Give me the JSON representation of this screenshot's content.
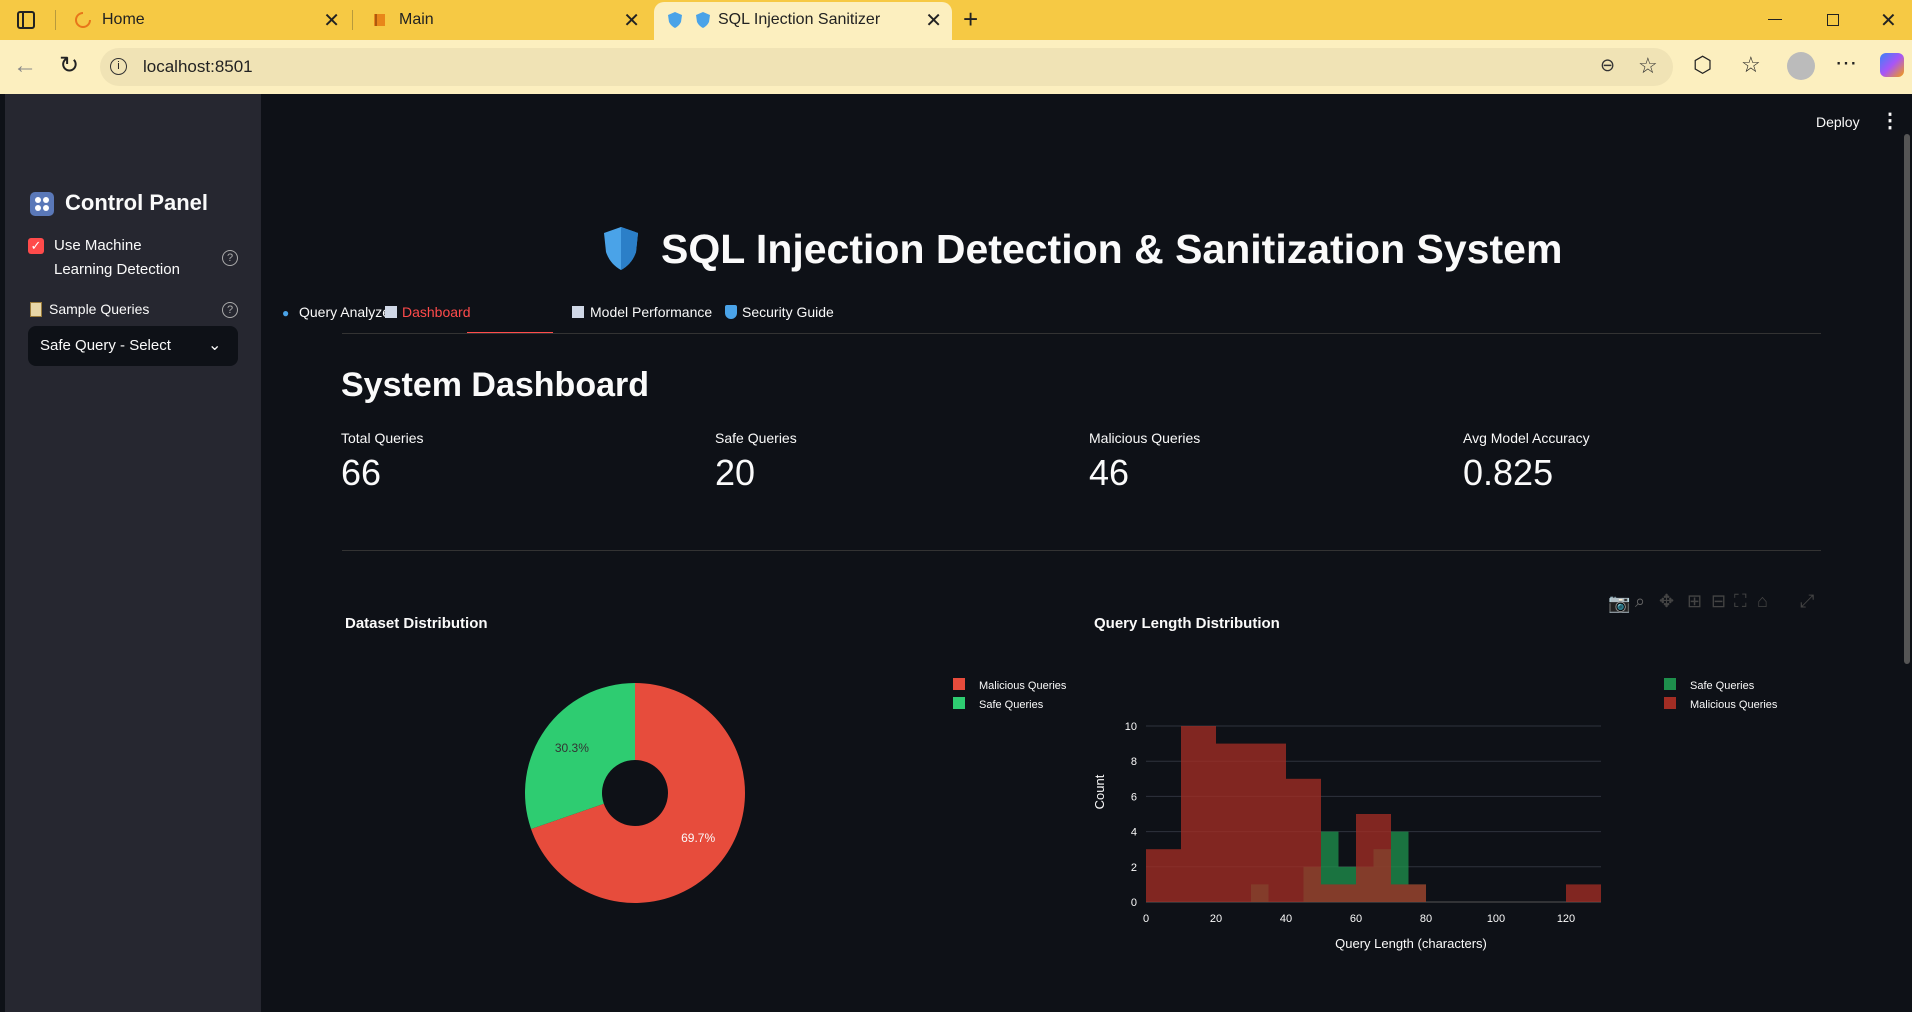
{
  "browser": {
    "tabs": [
      {
        "label": "Home",
        "icon": "loading-spinner-icon"
      },
      {
        "label": "Main",
        "icon": "book-icon"
      },
      {
        "label": "SQL Injection Sanitizer",
        "icon": "shield-icon",
        "active": true
      }
    ],
    "url": "localhost:8501"
  },
  "app": {
    "deploy_label": "Deploy",
    "title": "SQL Injection Detection & Sanitization System",
    "tabs": [
      {
        "label": "Query Analyzer",
        "icon": "magnifier-icon"
      },
      {
        "label": "Dashboard",
        "icon": "bar-chart-icon",
        "active": true
      },
      {
        "label": "Model Performance",
        "icon": "trend-chart-icon"
      },
      {
        "label": "Security Guide",
        "icon": "shield-icon"
      }
    ],
    "accent": "#ff4b4b"
  },
  "sidebar": {
    "title": "Control Panel",
    "ml_checkbox_label": "Use Machine Learning Detection",
    "ml_checkbox_checked": true,
    "sample_label": "Sample Queries",
    "sample_value": "Safe Query - Select"
  },
  "dashboard": {
    "heading": "System Dashboard",
    "metrics": [
      {
        "label": "Total Queries",
        "value": "66"
      },
      {
        "label": "Safe Queries",
        "value": "20"
      },
      {
        "label": "Malicious Queries",
        "value": "46"
      },
      {
        "label": "Avg Model Accuracy",
        "value": "0.825"
      }
    ]
  },
  "chart_data": [
    {
      "type": "pie",
      "title": "Dataset Distribution",
      "hole": true,
      "slices": [
        {
          "name": "Malicious Queries",
          "value": 46,
          "label": "69.7%",
          "color": "#e74c3c"
        },
        {
          "name": "Safe Queries",
          "value": 20,
          "label": "30.3%",
          "color": "#2ecc71"
        }
      ],
      "legend_position": "right"
    },
    {
      "type": "bar",
      "subtype": "histogram-overlay",
      "title": "Query Length Distribution",
      "xlabel": "Query Length (characters)",
      "ylabel": "Count",
      "xlim": [
        0,
        130
      ],
      "ylim": [
        0,
        10.5
      ],
      "xticks": [
        0,
        20,
        40,
        60,
        80,
        100,
        120
      ],
      "yticks": [
        0,
        2,
        4,
        6,
        8,
        10
      ],
      "bin_width": 10,
      "grid": true,
      "legend_position": "right",
      "series": [
        {
          "name": "Safe Queries",
          "color": "#1e8f4c",
          "bins": [
            [
              30,
              35,
              1
            ],
            [
              45,
              50,
              2
            ],
            [
              50,
              55,
              4
            ],
            [
              55,
              60,
              2
            ],
            [
              60,
              65,
              2
            ],
            [
              65,
              70,
              3
            ],
            [
              70,
              75,
              4
            ],
            [
              75,
              80,
              1
            ]
          ]
        },
        {
          "name": "Malicious Queries",
          "color": "#a12d24",
          "bins": [
            [
              0,
              10,
              3
            ],
            [
              10,
              20,
              10
            ],
            [
              20,
              40,
              9
            ],
            [
              40,
              50,
              7
            ],
            [
              50,
              60,
              1
            ],
            [
              60,
              70,
              5
            ],
            [
              70,
              80,
              1
            ],
            [
              120,
              130,
              1
            ]
          ]
        }
      ]
    }
  ]
}
